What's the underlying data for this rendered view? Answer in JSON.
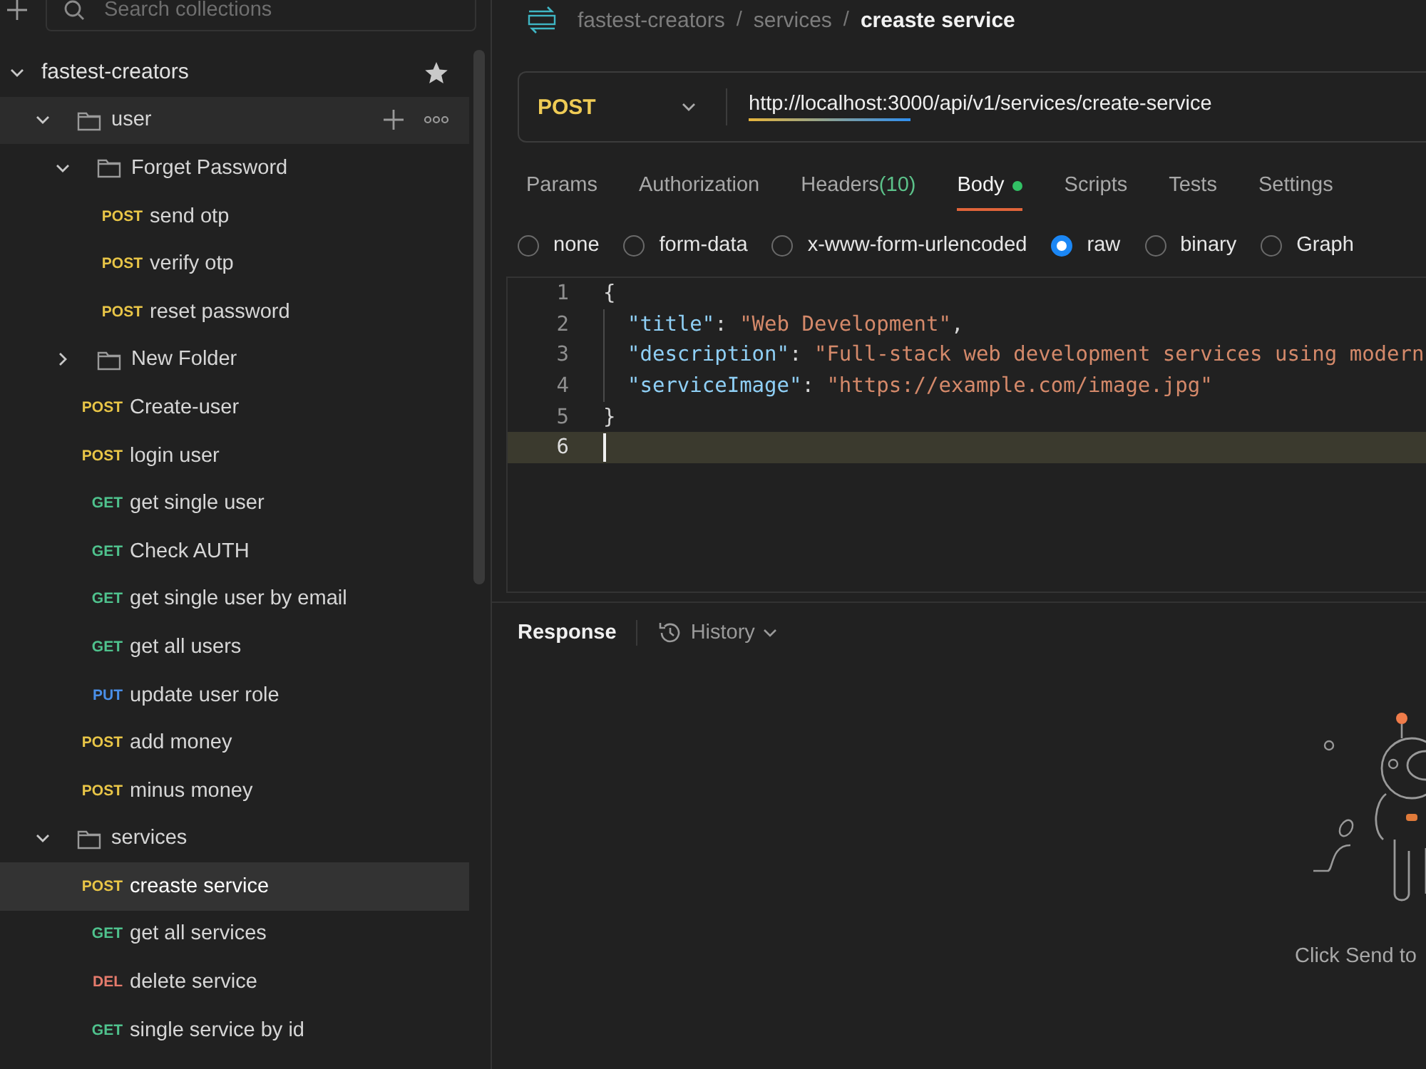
{
  "sidebar": {
    "search": {
      "placeholder": "Search collections"
    },
    "tree": [
      {
        "kind": "collection",
        "name": "fastest-creators",
        "expanded": true,
        "children": [
          {
            "kind": "folder",
            "name": "user",
            "expanded": true,
            "hovered": true,
            "children": [
              {
                "kind": "folder",
                "name": "Forget Password",
                "expanded": true,
                "hovered": false,
                "children": [
                  {
                    "kind": "request",
                    "method": "POST",
                    "color": "#e8c547",
                    "name": "send otp",
                    "selected": false
                  },
                  {
                    "kind": "request",
                    "method": "POST",
                    "color": "#e8c547",
                    "name": "verify otp",
                    "selected": false
                  },
                  {
                    "kind": "request",
                    "method": "POST",
                    "color": "#e8c547",
                    "name": "reset password",
                    "selected": false
                  }
                ]
              },
              {
                "kind": "folder",
                "name": "New Folder",
                "expanded": false,
                "hovered": false
              },
              {
                "kind": "request",
                "method": "POST",
                "color": "#e8c547",
                "name": "Create-user",
                "selected": false
              },
              {
                "kind": "request",
                "method": "POST",
                "color": "#e8c547",
                "name": "login user",
                "selected": false
              },
              {
                "kind": "request",
                "method": "GET",
                "color": "#4fc28d",
                "name": "get single user",
                "selected": false
              },
              {
                "kind": "request",
                "method": "GET",
                "color": "#4fc28d",
                "name": "Check AUTH",
                "selected": false
              },
              {
                "kind": "request",
                "method": "GET",
                "color": "#4fc28d",
                "name": "get single user by email",
                "selected": false
              },
              {
                "kind": "request",
                "method": "GET",
                "color": "#4fc28d",
                "name": "get all users",
                "selected": false
              },
              {
                "kind": "request",
                "method": "PUT",
                "color": "#4a8fe8",
                "name": "update user role",
                "selected": false
              },
              {
                "kind": "request",
                "method": "POST",
                "color": "#e8c547",
                "name": "add money",
                "selected": false
              },
              {
                "kind": "request",
                "method": "POST",
                "color": "#e8c547",
                "name": "minus money",
                "selected": false
              }
            ]
          },
          {
            "kind": "folder",
            "name": "services",
            "expanded": true,
            "hovered": false,
            "children": [
              {
                "kind": "request",
                "method": "POST",
                "color": "#e8c547",
                "name": "creaste service",
                "selected": true
              },
              {
                "kind": "request",
                "method": "GET",
                "color": "#4fc28d",
                "name": "get all services",
                "selected": false
              },
              {
                "kind": "request",
                "method": "DEL",
                "color": "#e57b6c",
                "name": "delete service",
                "selected": false
              },
              {
                "kind": "request",
                "method": "GET",
                "color": "#4fc28d",
                "name": "single service by id",
                "selected": false
              }
            ]
          }
        ]
      }
    ]
  },
  "breadcrumb": [
    {
      "kind": "link",
      "text": "fastest-creators"
    },
    {
      "kind": "separator",
      "text": "/"
    },
    {
      "kind": "link",
      "text": "services"
    },
    {
      "kind": "separator",
      "text": "/"
    },
    {
      "kind": "current",
      "text": "creaste service"
    }
  ],
  "request": {
    "method": "POST",
    "url": "http://localhost:3000/api/v1/services/create-service"
  },
  "tabs": [
    {
      "label": "Params",
      "selected": false,
      "dot": false
    },
    {
      "label": "Authorization",
      "selected": false,
      "dot": false
    },
    {
      "label": "Headers",
      "count": "(10)",
      "selected": false,
      "dot": false
    },
    {
      "label": "Body",
      "selected": true,
      "dot": true
    },
    {
      "label": "Scripts",
      "selected": false,
      "dot": false
    },
    {
      "label": "Tests",
      "selected": false,
      "dot": false
    },
    {
      "label": "Settings",
      "selected": false,
      "dot": false
    }
  ],
  "body_types": [
    {
      "label": "none",
      "selected": false
    },
    {
      "label": "form-data",
      "selected": false
    },
    {
      "label": "x-www-form-urlencoded",
      "selected": false
    },
    {
      "label": "raw",
      "selected": true
    },
    {
      "label": "binary",
      "selected": false
    },
    {
      "label": "Graph",
      "selected": false
    }
  ],
  "editor": {
    "lines": [
      {
        "number": "1",
        "indented": false,
        "current": false,
        "tokens": [
          {
            "kind": "punct",
            "text": "{"
          }
        ]
      },
      {
        "number": "2",
        "indented": true,
        "current": false,
        "tokens": [
          {
            "kind": "key",
            "text": "\"title\""
          },
          {
            "kind": "punct",
            "text": ": "
          },
          {
            "kind": "string",
            "text": "\"Web Development\""
          },
          {
            "kind": "punct",
            "text": ","
          }
        ]
      },
      {
        "number": "3",
        "indented": true,
        "current": false,
        "tokens": [
          {
            "kind": "key",
            "text": "\"description\""
          },
          {
            "kind": "punct",
            "text": ": "
          },
          {
            "kind": "string",
            "text": "\"Full-stack web development services using modern"
          }
        ]
      },
      {
        "number": "4",
        "indented": true,
        "current": false,
        "tokens": [
          {
            "kind": "key",
            "text": "\"serviceImage\""
          },
          {
            "kind": "punct",
            "text": ": "
          },
          {
            "kind": "string",
            "text": "\"https://example.com/image.jpg\""
          }
        ]
      },
      {
        "number": "5",
        "indented": false,
        "current": false,
        "tokens": [
          {
            "kind": "punct",
            "text": "}"
          }
        ]
      },
      {
        "number": "6",
        "indented": false,
        "current": true
      }
    ]
  },
  "response": {
    "title": "Response",
    "history": "History",
    "empty_text": "Click Send to"
  }
}
